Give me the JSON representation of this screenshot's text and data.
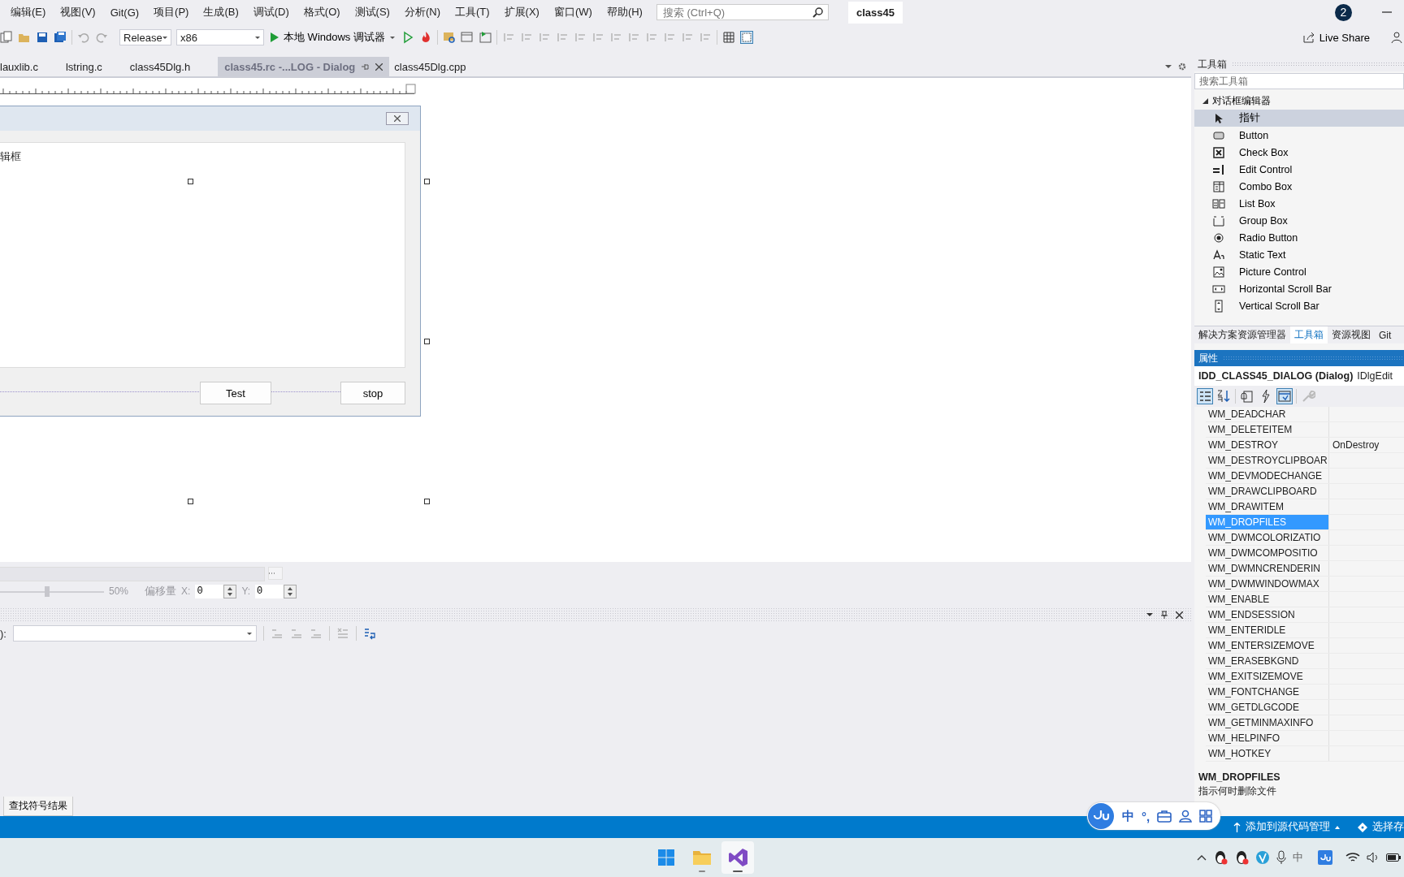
{
  "menu": [
    {
      "label": "编辑(E)"
    },
    {
      "label": "视图(V)"
    },
    {
      "label": "Git(G)"
    },
    {
      "label": "项目(P)"
    },
    {
      "label": "生成(B)"
    },
    {
      "label": "调试(D)"
    },
    {
      "label": "格式(O)"
    },
    {
      "label": "测试(S)"
    },
    {
      "label": "分析(N)"
    },
    {
      "label": "工具(T)"
    },
    {
      "label": "扩展(X)"
    },
    {
      "label": "窗口(W)"
    },
    {
      "label": "帮助(H)"
    }
  ],
  "search": {
    "placeholder": "搜索 (Ctrl+Q)"
  },
  "solution_name": "class45",
  "notification_count": "2",
  "toolbar": {
    "configuration": "Release",
    "platform": "x86",
    "run_label": "本地 Windows 调试器",
    "live_share": "Live Share"
  },
  "tabs": [
    {
      "label": "lauxlib.c",
      "selected": false
    },
    {
      "label": "lstring.c",
      "selected": false
    },
    {
      "label": "class45Dlg.h",
      "selected": false
    },
    {
      "label": "class45.rc -...LOG - Dialog",
      "selected": true
    },
    {
      "label": "class45Dlg.cpp",
      "selected": false
    }
  ],
  "dialog": {
    "edit_text": "辑框",
    "buttons": [
      "Test",
      "stop"
    ]
  },
  "zoom_bar": {
    "level": 0.45,
    "reading": "50%",
    "offset_label": "偏移量",
    "x_label": "X:",
    "x_value": "0",
    "y_label": "Y:",
    "y_value": "0"
  },
  "bottom_panel": {
    "label": "):",
    "tab": "查找符号结果"
  },
  "toolbox": {
    "title": "工具箱",
    "placeholder": "搜索工具箱",
    "group": "对话框编辑器",
    "expanded": true,
    "items": [
      {
        "label": "指针",
        "selected": true
      },
      {
        "label": "Button",
        "selected": false
      },
      {
        "label": "Check Box",
        "selected": false
      },
      {
        "label": "Edit Control",
        "selected": false
      },
      {
        "label": "Combo Box",
        "selected": false
      },
      {
        "label": "List Box",
        "selected": false
      },
      {
        "label": "Group Box",
        "selected": false
      },
      {
        "label": "Radio Button",
        "selected": false
      },
      {
        "label": "Static Text",
        "selected": false
      },
      {
        "label": "Picture Control",
        "selected": false
      },
      {
        "label": "Horizontal Scroll Bar",
        "selected": false
      },
      {
        "label": "Vertical Scroll Bar",
        "selected": false
      }
    ]
  },
  "panel_tabs": [
    {
      "label": "解决方案资源管理器",
      "selected": false
    },
    {
      "label": "工具箱",
      "selected": true
    },
    {
      "label": "资源视图",
      "selected": false
    },
    {
      "label": "Git",
      "selected": false
    }
  ],
  "properties": {
    "title": "属性",
    "object": "IDD_CLASS45_DIALOG (Dialog)",
    "object_type": "IDlgEdit",
    "rows": [
      {
        "name": "WM_DEADCHAR",
        "selected": false
      },
      {
        "name": "WM_DELETEITEM",
        "selected": false
      },
      {
        "name": "WM_DESTROY",
        "value": "OnDestroy",
        "selected": false
      },
      {
        "name": "WM_DESTROYCLIPBOAR",
        "selected": false
      },
      {
        "name": "WM_DEVMODECHANGE",
        "selected": false
      },
      {
        "name": "WM_DRAWCLIPBOARD",
        "selected": false
      },
      {
        "name": "WM_DRAWITEM",
        "selected": false
      },
      {
        "name": "WM_DROPFILES",
        "selected": true
      },
      {
        "name": "WM_DWMCOLORIZATIO",
        "selected": false
      },
      {
        "name": "WM_DWMCOMPOSITIO",
        "selected": false
      },
      {
        "name": "WM_DWMNCRENDERIN",
        "selected": false
      },
      {
        "name": "WM_DWMWINDOWMAX",
        "selected": false
      },
      {
        "name": "WM_ENABLE",
        "selected": false
      },
      {
        "name": "WM_ENDSESSION",
        "selected": false
      },
      {
        "name": "WM_ENTERIDLE",
        "selected": false
      },
      {
        "name": "WM_ENTERSIZEMOVE",
        "selected": false
      },
      {
        "name": "WM_ERASEBKGND",
        "selected": false
      },
      {
        "name": "WM_EXITSIZEMOVE",
        "selected": false
      },
      {
        "name": "WM_FONTCHANGE",
        "selected": false
      },
      {
        "name": "WM_GETDLGCODE",
        "selected": false
      },
      {
        "name": "WM_GETMINMAXINFO",
        "selected": false
      },
      {
        "name": "WM_HELPINFO",
        "selected": false
      },
      {
        "name": "WM_HOTKEY",
        "selected": false
      }
    ],
    "description_title": "WM_DROPFILES",
    "description": "指示何时删除文件"
  },
  "status_bar": {
    "source_control": "添加到源代码管理",
    "repository": "选择存"
  },
  "ime_toolbar": {
    "language": "中",
    "punctuation": "°,"
  },
  "tray": {
    "input_language": "中"
  }
}
